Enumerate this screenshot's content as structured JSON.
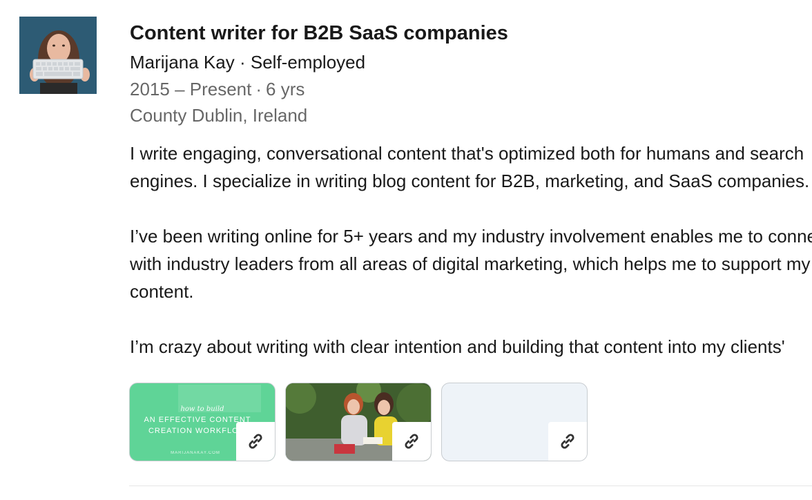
{
  "experience": {
    "title": "Content writer for B2B SaaS companies",
    "company": "Marijana Kay",
    "employment_type": "Self-employed",
    "separator": "·",
    "date_range": "2015 – Present",
    "duration": "6 yrs",
    "location": "County Dublin, Ireland",
    "description": [
      [
        "I write engaging, conversational content that's optimized both for humans and search",
        "engines. I specialize in writing blog content for B2B, marketing, and SaaS companies."
      ],
      [
        "I’ve been writing online for 5+ years and my industry involvement enables me to connect",
        "with industry leaders from all areas of digital marketing, which helps me to support my",
        "content."
      ],
      [
        "I’m crazy about writing with clear intention and building that content into my clients'"
      ]
    ]
  },
  "media": [
    {
      "kind": "thumbnail",
      "text_small": "how to build",
      "text_line1": "AN EFFECTIVE CONTENT",
      "text_line2": "CREATION WORKFLOW",
      "text_footer": "MARIJANAKAY.COM",
      "link_icon": "link-icon"
    },
    {
      "kind": "photo",
      "link_icon": "link-icon"
    },
    {
      "kind": "empty",
      "link_icon": "link-icon"
    }
  ],
  "colors": {
    "thumb_green": "#5fd497",
    "thumb_empty": "#eef3f8",
    "meta_text": "#666666"
  }
}
